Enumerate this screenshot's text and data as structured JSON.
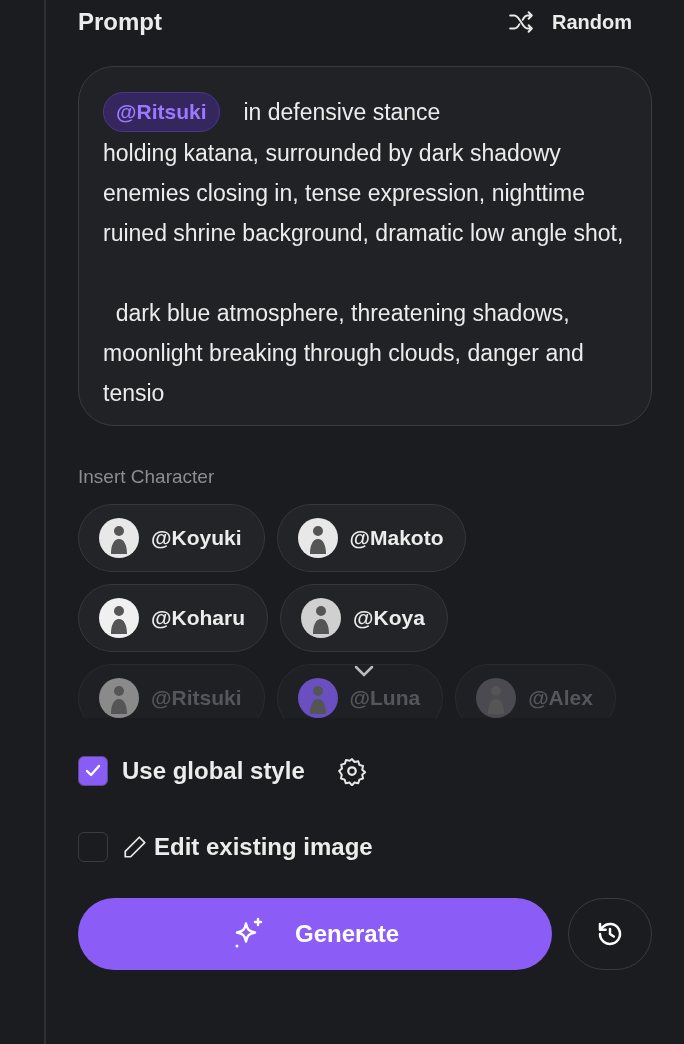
{
  "header": {
    "title": "Prompt",
    "random_label": "Random"
  },
  "prompt": {
    "mention": "@Ritsuki",
    "first_line": "in defensive stance",
    "text": "holding katana, surrounded by dark shadowy enemies closing in, tense expression, nighttime ruined shrine background, dramatic low angle shot,\n\n  dark blue atmosphere, threatening shadows, moonlight breaking through clouds, danger and tensio"
  },
  "insert_character": {
    "label": "Insert Character",
    "characters": [
      {
        "name": "@Koyuki",
        "color": "#e8e8e8"
      },
      {
        "name": "@Makoto",
        "color": "#e8e8e8"
      },
      {
        "name": "@Koharu",
        "color": "#f0f0f0"
      },
      {
        "name": "@Koya",
        "color": "#d0d0d0"
      },
      {
        "name": "@Ritsuki",
        "color": "#8a8a8a"
      },
      {
        "name": "@Luna",
        "color": "#6a4fc0"
      },
      {
        "name": "@Alex",
        "color": "#4a4a50"
      }
    ]
  },
  "options": [
    {
      "kind": "style",
      "label": "Use global style",
      "checked": true
    },
    {
      "kind": "edit",
      "label": "Edit existing image",
      "checked": false
    }
  ],
  "generate_label": "Generate"
}
